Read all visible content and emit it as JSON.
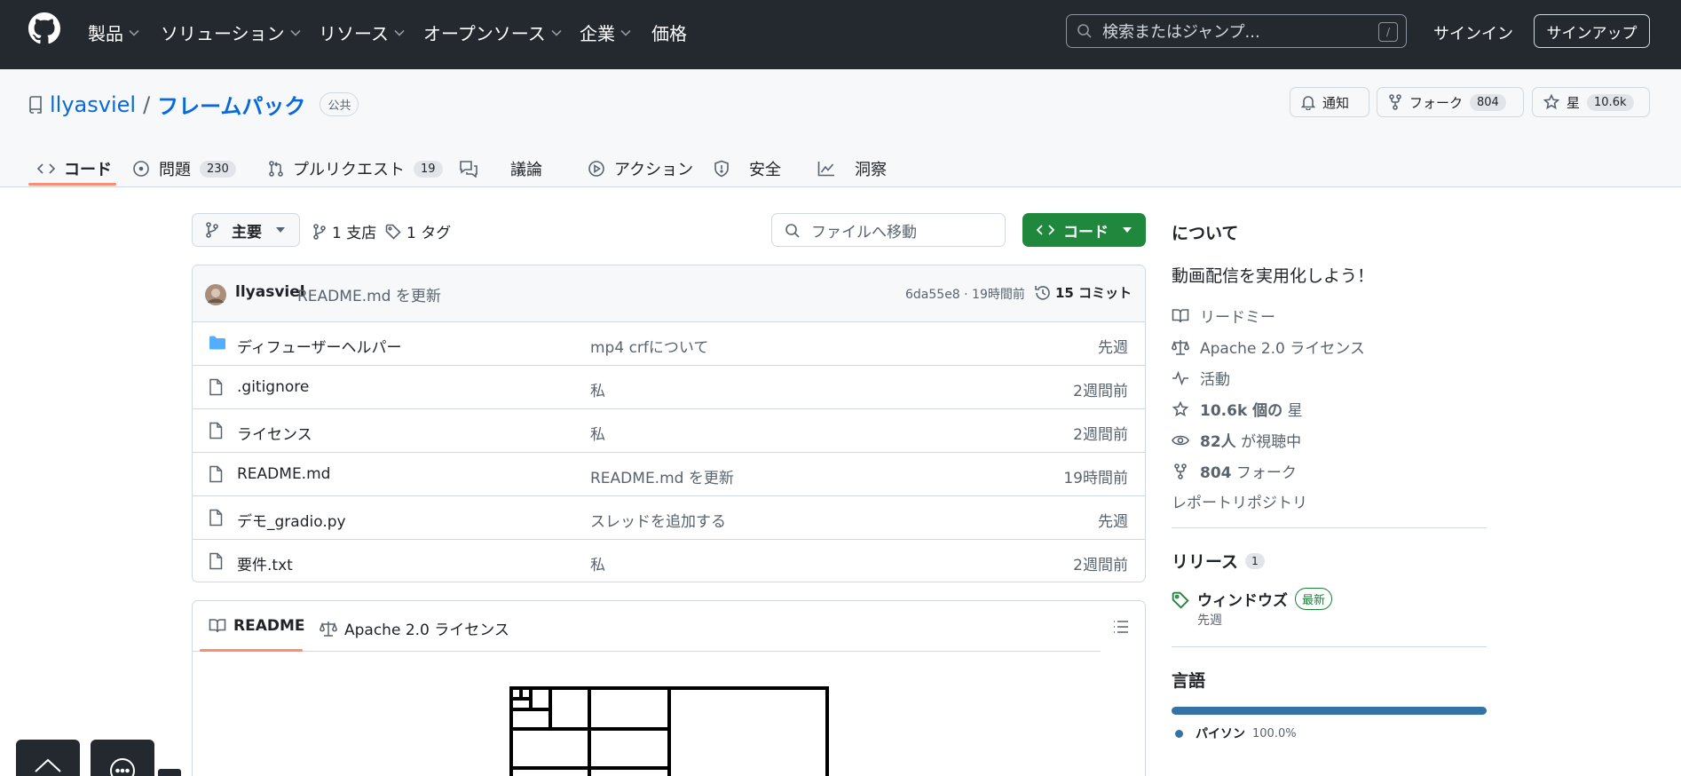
{
  "nav": {
    "items": [
      "製品",
      "ソリューション",
      "リソース",
      "オープンソース",
      "企業",
      "価格"
    ],
    "search_placeholder": "検索またはジャンプ...",
    "search_key": "/",
    "signin": "サインイン",
    "signup": "サインアップ"
  },
  "repo": {
    "owner": "llyasviel",
    "slash": "/",
    "name": "フレームパック",
    "visibility": "公共",
    "notify_label": "通知",
    "fork_label": "フォーク",
    "fork_count": "804",
    "star_label": "星",
    "star_count": "10.6k"
  },
  "tabs": [
    {
      "label": "コード"
    },
    {
      "label": "問題",
      "count": "230"
    },
    {
      "label": "プルリクエスト",
      "count": "19"
    },
    {
      "label": "議論"
    },
    {
      "label": "アクション"
    },
    {
      "label": "安全"
    },
    {
      "label": "洞察"
    }
  ],
  "toolbar": {
    "branch": "主要",
    "branches": "1 支店",
    "tags": "1 タグ",
    "file_search_placeholder": "ファイルへ移動",
    "code_button": "コード"
  },
  "commit": {
    "author": "llyasviel",
    "message": "README.md を更新",
    "hash_time": "6da55e8 · 19時間前",
    "commits": "15 コミット"
  },
  "files": [
    {
      "name": "ディフューザーヘルパー",
      "type": "folder",
      "message": "mp4 crfについて",
      "date": "先週"
    },
    {
      "name": ".gitignore",
      "type": "file",
      "message": "私",
      "date": "2週間前"
    },
    {
      "name": "ライセンス",
      "type": "file",
      "message": "私",
      "date": "2週間前"
    },
    {
      "name": "README.md",
      "type": "file",
      "message": "README.md を更新",
      "date": "19時間前"
    },
    {
      "name": "デモ_gradio.py",
      "type": "file",
      "message": "スレッドを追加する",
      "date": "先週"
    },
    {
      "name": "要件.txt",
      "type": "file",
      "message": "私",
      "date": "2週間前"
    }
  ],
  "readme": {
    "tab_readme": "README",
    "tab_license": "Apache 2.0 ライセンス"
  },
  "about": {
    "heading": "について",
    "description": "動画配信を実用化しよう！",
    "readme": "リードミー",
    "license": "Apache 2.0 ライセンス",
    "activity": "活動",
    "stars_count": "10.6k 個の",
    "stars_label": "星",
    "watching_count": "82人",
    "watching_label": "が視聴中",
    "forks_count": "804",
    "forks_label": "フォーク",
    "report": "レポートリポジトリ"
  },
  "releases": {
    "heading": "リリース",
    "count": "1",
    "name": "ウィンドウズ",
    "badge": "最新",
    "date": "先週"
  },
  "languages": {
    "heading": "言語",
    "items": [
      {
        "name": "パイソン",
        "percent": "100.0%",
        "fraction": 1.0,
        "color": "#3572A5"
      }
    ]
  },
  "colors": {
    "header_bg": "#24292f",
    "link": "#0969da",
    "green": "#1f883d",
    "tab_underline": "#fd8c73"
  }
}
